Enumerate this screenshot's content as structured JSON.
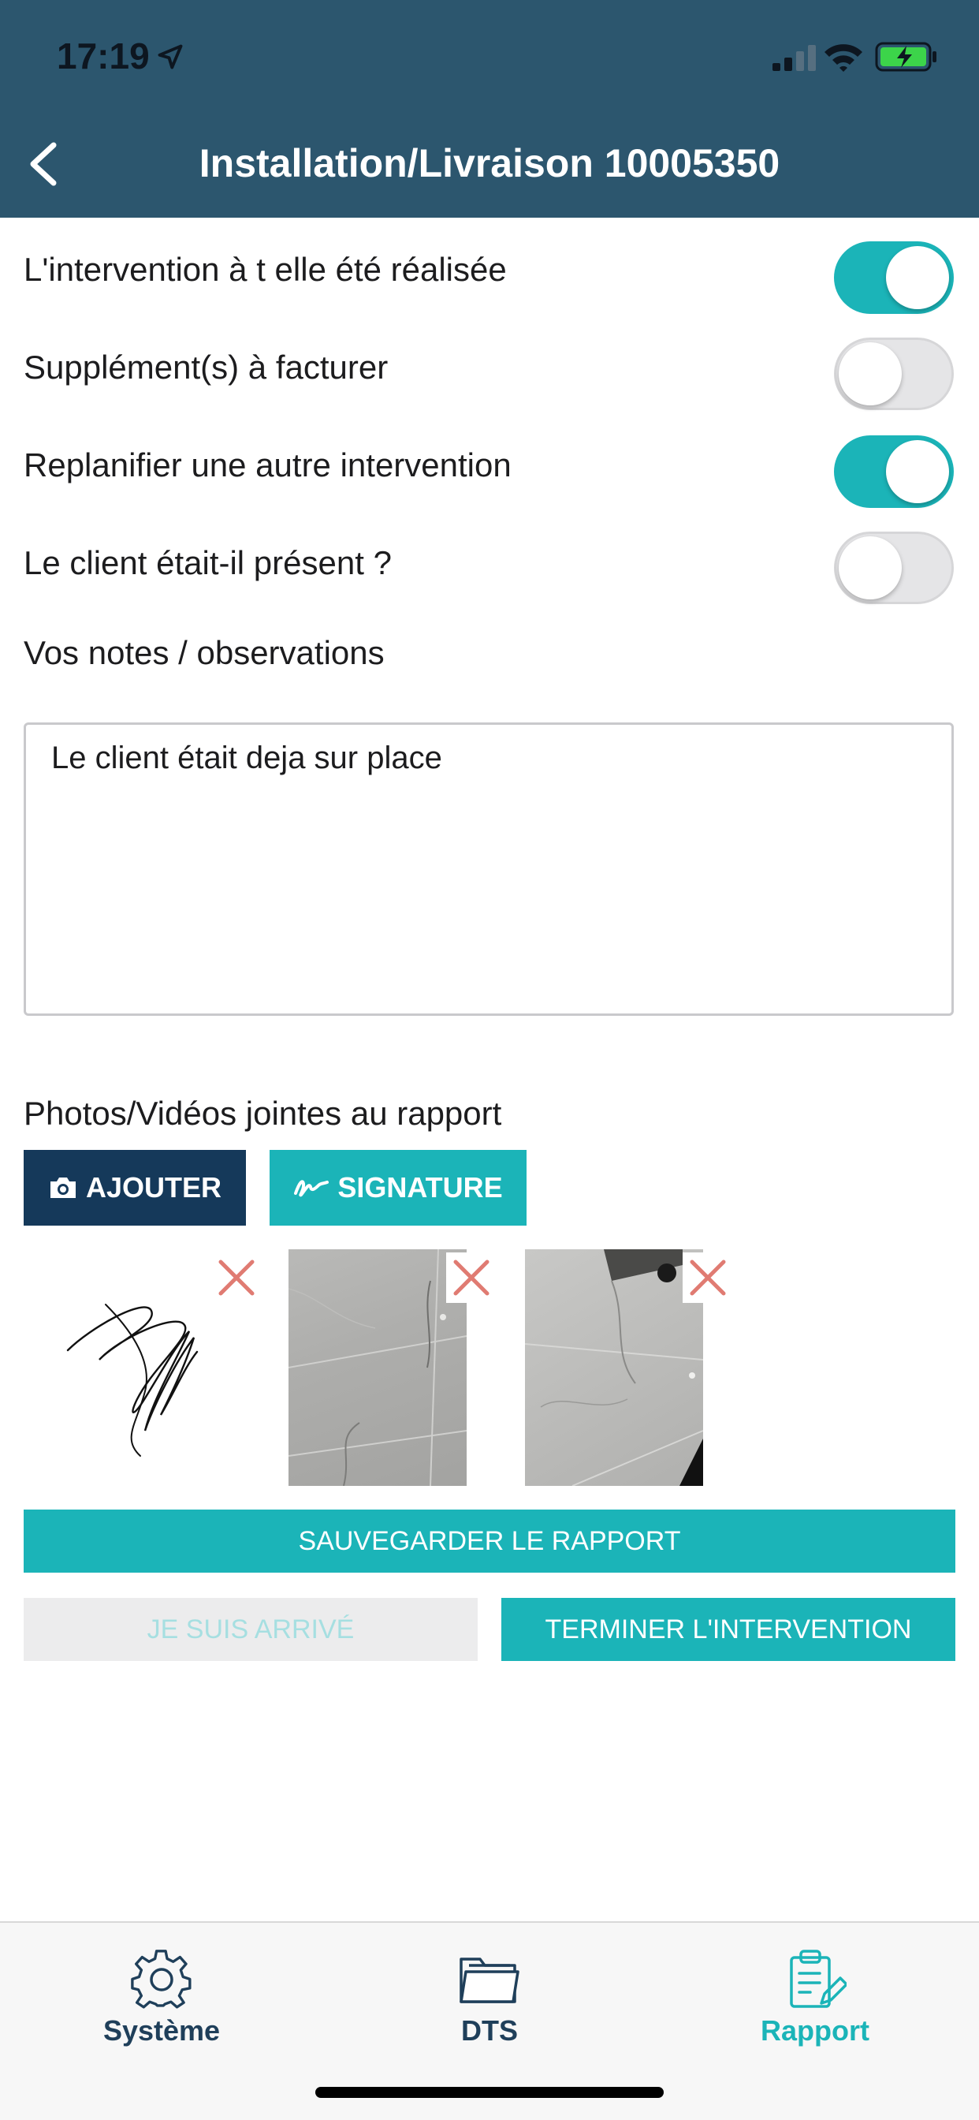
{
  "status_bar": {
    "time": "17:19"
  },
  "header": {
    "title": "Installation/Livraison 10005350"
  },
  "toggles": [
    {
      "label": "L'intervention à t elle été réalisée",
      "on": true
    },
    {
      "label": "Supplément(s) à facturer",
      "on": false
    },
    {
      "label": "Replanifier une autre intervention",
      "on": true
    },
    {
      "label": "Le client était-il présent ?",
      "on": false
    }
  ],
  "notes": {
    "label": "Vos notes / observations",
    "value": "Le client était deja sur place"
  },
  "attachments": {
    "label": "Photos/Vidéos jointes au rapport",
    "add_label": "AJOUTER",
    "signature_label": "SIGNATURE"
  },
  "actions": {
    "save_label": "SAUVEGARDER LE RAPPORT",
    "arrived_label": "JE SUIS ARRIVÉ",
    "finish_label": "TERMINER L'INTERVENTION"
  },
  "tabbar": {
    "items": [
      {
        "label": "Système",
        "icon": "gear-icon",
        "active": false
      },
      {
        "label": "DTS",
        "icon": "folder-icon",
        "active": false
      },
      {
        "label": "Rapport",
        "icon": "clipboard-edit-icon",
        "active": true
      }
    ]
  },
  "colors": {
    "header": "#2c566e",
    "accent": "#1bb4b8",
    "dark_button": "#15395a",
    "delete_icon": "#e07b72"
  }
}
